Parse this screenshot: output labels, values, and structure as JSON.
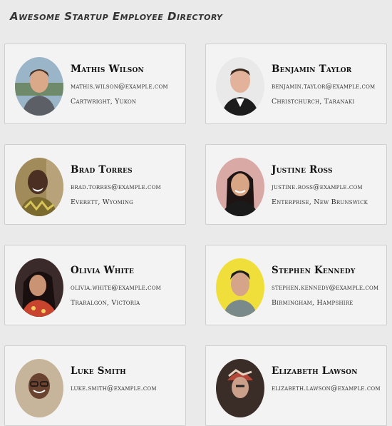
{
  "page": {
    "title": "Awesome Startup Employee Directory"
  },
  "employees": [
    {
      "name": "Mathis Wilson",
      "email": "mathis.wilson@example.com",
      "location": "Cartwright, Yukon"
    },
    {
      "name": "Benjamin Taylor",
      "email": "benjamin.taylor@example.com",
      "location": "Christchurch, Taranaki"
    },
    {
      "name": "Brad Torres",
      "email": "brad.torres@example.com",
      "location": "Everett, Wyoming"
    },
    {
      "name": "Justine Ross",
      "email": "justine.ross@example.com",
      "location": "Enterprise, New Brunswick"
    },
    {
      "name": "Olivia White",
      "email": "olivia.white@example.com",
      "location": "Traralgon, Victoria"
    },
    {
      "name": "Stephen Kennedy",
      "email": "stephen.kennedy@example.com",
      "location": "Birmingham, Hampshire"
    },
    {
      "name": "Luke Smith",
      "email": "luke.smith@example.com",
      "location": ""
    },
    {
      "name": "Elizabeth Lawson",
      "email": "elizabeth.lawson@example.com",
      "location": ""
    }
  ],
  "colors": {
    "background": "#eaeaea",
    "card": "#f3f3f3",
    "card_border": "#cfcfcf"
  }
}
